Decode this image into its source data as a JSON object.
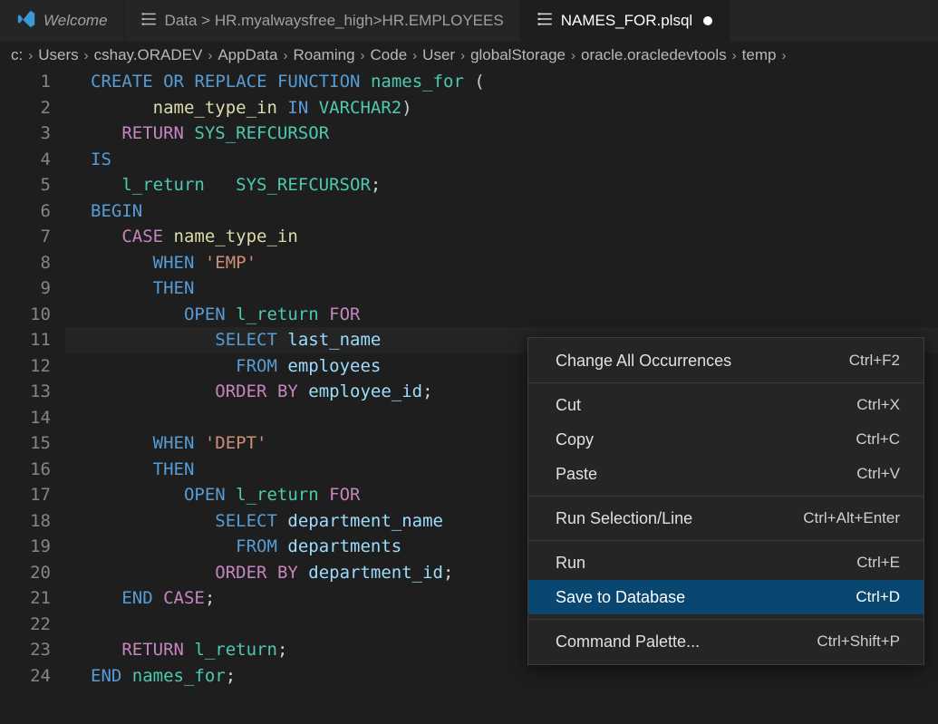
{
  "tabs": [
    {
      "label": "Welcome",
      "italic": true
    },
    {
      "label": "Data > HR.myalwaysfree_high>HR.EMPLOYEES",
      "kind": "preview"
    },
    {
      "label": "NAMES_FOR.plsql",
      "active": true,
      "dirty": true,
      "kind": "preview"
    }
  ],
  "breadcrumb": [
    "c:",
    "Users",
    "cshay.ORADEV",
    "AppData",
    "Roaming",
    "Code",
    "User",
    "globalStorage",
    "oracle.oracledevtools",
    "temp"
  ],
  "code_lines": [
    [
      {
        "t": "CREATE",
        "c": "kw"
      },
      {
        "t": " "
      },
      {
        "t": "OR",
        "c": "kw"
      },
      {
        "t": " "
      },
      {
        "t": "REPLACE",
        "c": "kw"
      },
      {
        "t": " "
      },
      {
        "t": "FUNCTION",
        "c": "kw"
      },
      {
        "t": " "
      },
      {
        "t": "names_for",
        "c": "type"
      },
      {
        "t": " ("
      }
    ],
    [
      {
        "t": "      "
      },
      {
        "t": "name_type_in",
        "c": "id"
      },
      {
        "t": " "
      },
      {
        "t": "IN",
        "c": "in"
      },
      {
        "t": " "
      },
      {
        "t": "VARCHAR2",
        "c": "type"
      },
      {
        "t": ")"
      }
    ],
    [
      {
        "t": "   "
      },
      {
        "t": "RETURN",
        "c": "kw2"
      },
      {
        "t": " "
      },
      {
        "t": "SYS_REFCURSOR",
        "c": "type"
      }
    ],
    [
      {
        "t": "IS",
        "c": "kw"
      }
    ],
    [
      {
        "t": "   "
      },
      {
        "t": "l_return",
        "c": "type"
      },
      {
        "t": "   "
      },
      {
        "t": "SYS_REFCURSOR",
        "c": "type"
      },
      {
        "t": ";",
        "c": "pun"
      }
    ],
    [
      {
        "t": "BEGIN",
        "c": "kw"
      }
    ],
    [
      {
        "t": "   "
      },
      {
        "t": "CASE",
        "c": "kw2"
      },
      {
        "t": " "
      },
      {
        "t": "name_type_in",
        "c": "id"
      }
    ],
    [
      {
        "t": "      "
      },
      {
        "t": "WHEN",
        "c": "kw"
      },
      {
        "t": " "
      },
      {
        "t": "'EMP'",
        "c": "str"
      }
    ],
    [
      {
        "t": "      "
      },
      {
        "t": "THEN",
        "c": "kw"
      }
    ],
    [
      {
        "t": "         "
      },
      {
        "t": "OPEN",
        "c": "kw"
      },
      {
        "t": " "
      },
      {
        "t": "l_return",
        "c": "type"
      },
      {
        "t": " "
      },
      {
        "t": "FOR",
        "c": "kw2"
      }
    ],
    [
      {
        "t": "            "
      },
      {
        "t": "SELECT",
        "c": "kw"
      },
      {
        "t": " "
      },
      {
        "t": "last_name",
        "c": "col"
      }
    ],
    [
      {
        "t": "              "
      },
      {
        "t": "FROM",
        "c": "kw"
      },
      {
        "t": " "
      },
      {
        "t": "employees",
        "c": "tbl"
      }
    ],
    [
      {
        "t": "            "
      },
      {
        "t": "ORDER",
        "c": "kw2"
      },
      {
        "t": " "
      },
      {
        "t": "BY",
        "c": "kw2"
      },
      {
        "t": " "
      },
      {
        "t": "employee_id",
        "c": "col"
      },
      {
        "t": ";",
        "c": "pun"
      }
    ],
    [],
    [
      {
        "t": "      "
      },
      {
        "t": "WHEN",
        "c": "kw"
      },
      {
        "t": " "
      },
      {
        "t": "'DEPT'",
        "c": "str"
      }
    ],
    [
      {
        "t": "      "
      },
      {
        "t": "THEN",
        "c": "kw"
      }
    ],
    [
      {
        "t": "         "
      },
      {
        "t": "OPEN",
        "c": "kw"
      },
      {
        "t": " "
      },
      {
        "t": "l_return",
        "c": "type"
      },
      {
        "t": " "
      },
      {
        "t": "FOR",
        "c": "kw2"
      }
    ],
    [
      {
        "t": "            "
      },
      {
        "t": "SELECT",
        "c": "kw"
      },
      {
        "t": " "
      },
      {
        "t": "department_name",
        "c": "col"
      }
    ],
    [
      {
        "t": "              "
      },
      {
        "t": "FROM",
        "c": "kw"
      },
      {
        "t": " "
      },
      {
        "t": "departments",
        "c": "tbl"
      }
    ],
    [
      {
        "t": "            "
      },
      {
        "t": "ORDER",
        "c": "kw2"
      },
      {
        "t": " "
      },
      {
        "t": "BY",
        "c": "kw2"
      },
      {
        "t": " "
      },
      {
        "t": "department_id",
        "c": "col"
      },
      {
        "t": ";",
        "c": "pun"
      }
    ],
    [
      {
        "t": "   "
      },
      {
        "t": "END",
        "c": "kw"
      },
      {
        "t": " "
      },
      {
        "t": "CASE",
        "c": "kw2"
      },
      {
        "t": ";",
        "c": "pun"
      }
    ],
    [],
    [
      {
        "t": "   "
      },
      {
        "t": "RETURN",
        "c": "kw2"
      },
      {
        "t": " "
      },
      {
        "t": "l_return",
        "c": "type"
      },
      {
        "t": ";",
        "c": "pun"
      }
    ],
    [
      {
        "t": "END",
        "c": "kw"
      },
      {
        "t": " "
      },
      {
        "t": "names_for",
        "c": "type"
      },
      {
        "t": ";",
        "c": "pun"
      }
    ]
  ],
  "highlight_line": 11,
  "menu": [
    {
      "label": "Change All Occurrences",
      "shortcut": "Ctrl+F2"
    },
    {
      "sep": true
    },
    {
      "label": "Cut",
      "shortcut": "Ctrl+X"
    },
    {
      "label": "Copy",
      "shortcut": "Ctrl+C"
    },
    {
      "label": "Paste",
      "shortcut": "Ctrl+V"
    },
    {
      "sep": true
    },
    {
      "label": "Run Selection/Line",
      "shortcut": "Ctrl+Alt+Enter"
    },
    {
      "sep": true
    },
    {
      "label": "Run",
      "shortcut": "Ctrl+E"
    },
    {
      "label": "Save to Database",
      "shortcut": "Ctrl+D",
      "selected": true
    },
    {
      "sep": true
    },
    {
      "label": "Command Palette...",
      "shortcut": "Ctrl+Shift+P"
    }
  ]
}
